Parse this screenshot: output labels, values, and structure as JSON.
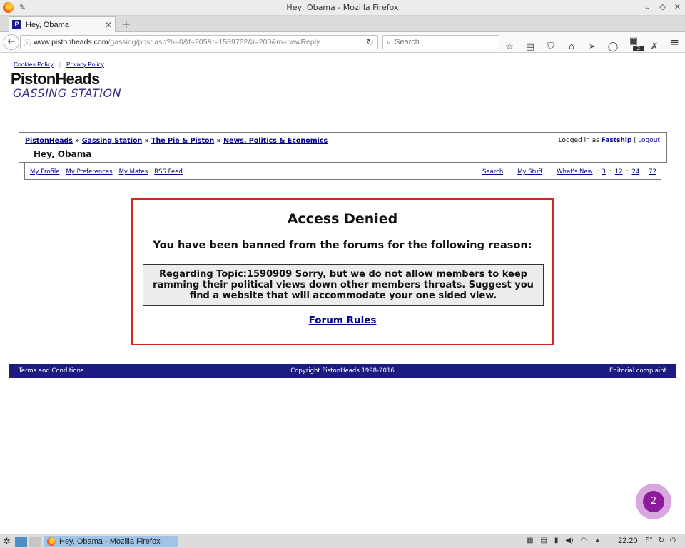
{
  "window": {
    "title": "Hey, Obama - Mozilla Firefox"
  },
  "tabs": [
    {
      "label": "Hey, Obama",
      "favicon": "P",
      "active": true
    }
  ],
  "navbar": {
    "url_domain": "www.pistonheads.com",
    "url_path": "/gassing/post.asp?h=0&f=205&t=1589762&i=200&m=newReply",
    "search_placeholder": "Search",
    "notification_count": "2"
  },
  "page": {
    "policies": [
      {
        "label": "Cookies Policy"
      },
      {
        "label": "Privacy Policy"
      }
    ],
    "logo": {
      "line1": "PistonHeads",
      "line2": "GASSING STATION"
    },
    "breadcrumbs": [
      {
        "label": "PistonHeads"
      },
      {
        "label": "Gassing Station"
      },
      {
        "label": "The Pie & Piston"
      },
      {
        "label": "News, Politics & Economics"
      }
    ],
    "breadcrumb_sep": "»",
    "title": "Hey, Obama",
    "login": {
      "prefix": "Logged in as",
      "user": "Fastship",
      "logout": "Logout"
    },
    "menu_left": [
      "My Profile",
      "My Preferences",
      "My Mates",
      "RSS Feed"
    ],
    "menu_right": {
      "search": "Search",
      "my_stuff": "My Stuff",
      "whats_new": "What's New",
      "periods": [
        "3",
        "12",
        "24",
        "72"
      ]
    },
    "denied": {
      "heading": "Access Denied",
      "subheading": "You have been banned from the forums for the following reason:",
      "reason": "Regarding Topic:1590909 Sorry, but we do not allow members to keep ramming their political views down other members throats. Suggest you find a website that will accommodate your one sided view.",
      "rules_link": "Forum Rules"
    },
    "footer": {
      "terms": "Terms and Conditions",
      "copyright": "Copyright PistonHeads 1998-2016",
      "complaint": "Editorial complaint"
    },
    "bubble_count": "2"
  },
  "taskbar": {
    "task_label": "Hey, Obama - Mozilla Firefox",
    "clock": "22:20",
    "temperature": "5°"
  },
  "colors": {
    "link": "#00008b",
    "denied_border": "#d42424",
    "footer_bg": "#1c1c80",
    "bubble": "#8d1a9b"
  }
}
